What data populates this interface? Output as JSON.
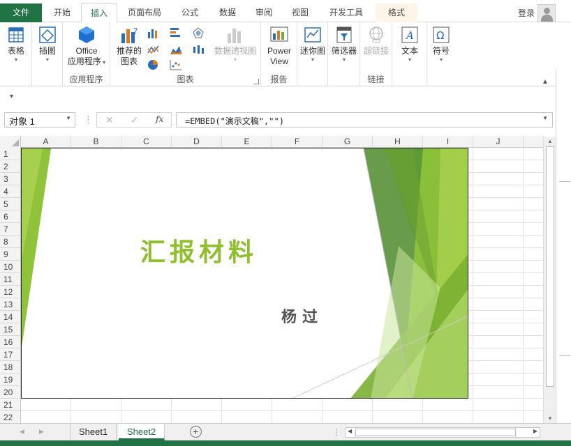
{
  "tabs": [
    "文件",
    "开始",
    "插入",
    "页面布局",
    "公式",
    "数据",
    "审阅",
    "视图",
    "开发工具",
    "格式"
  ],
  "active_tab": "插入",
  "login": "登录",
  "ribbon": {
    "table": "表格",
    "illustrations": "插图",
    "office_apps_line1": "Office",
    "office_apps_line2": "应用程序",
    "group_apps": "应用程序",
    "recommended_line1": "推荐的",
    "recommended_line2": "图表",
    "pivotchart": "数据透视图",
    "group_charts": "图表",
    "powerview_line1": "Power",
    "powerview_line2": "View",
    "group_reports": "报告",
    "sparklines": "迷你图",
    "filters": "筛选器",
    "hyperlink": "超链接",
    "group_links": "链接",
    "text": "文本",
    "symbols": "符号"
  },
  "namebox": "对象 1",
  "formula": "=EMBED(\"演示文稿\",\"\")",
  "columns": [
    "A",
    "B",
    "C",
    "D",
    "E",
    "F",
    "G",
    "H",
    "I",
    "J"
  ],
  "rows": [
    "1",
    "2",
    "3",
    "4",
    "5",
    "6",
    "7",
    "8",
    "9",
    "10",
    "11",
    "12",
    "13",
    "14",
    "15",
    "16",
    "17",
    "18",
    "19",
    "20",
    "21",
    "22"
  ],
  "slide": {
    "title": "汇报材料",
    "author": "杨过",
    "accent": "#8fbf2c"
  },
  "sheets": [
    "Sheet1",
    "Sheet2"
  ],
  "active_sheet": "Sheet2"
}
